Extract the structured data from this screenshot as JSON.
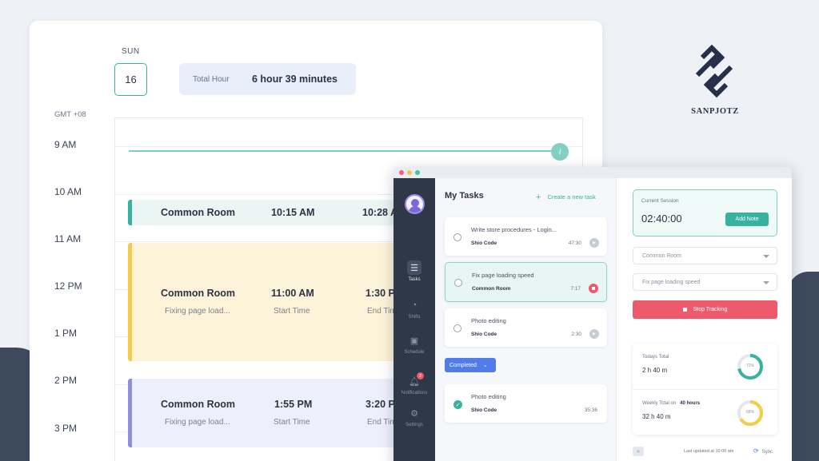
{
  "calendar": {
    "day_name": "SUN",
    "day_number": "16",
    "total_label": "Total Hour",
    "total_value": "6 hour 39 minutes",
    "timezone": "GMT +08",
    "hours": [
      "9 AM",
      "10 AM",
      "11 AM",
      "12 PM",
      "1 PM",
      "2 PM",
      "3 PM"
    ],
    "now_marker": "i",
    "events": [
      {
        "location": "Common Room",
        "start": "10:15 AM",
        "end": "10:28 A",
        "color": "#38b2a0"
      },
      {
        "location": "Common Room",
        "subtitle": "Fixing page load...",
        "start": "11:00 AM",
        "start_label": "Start Time",
        "end": "1:30 P",
        "end_label": "End Tim",
        "color": "#f4cc45"
      },
      {
        "location": "Common Room",
        "subtitle": "Fixing page load...",
        "start": "1:55 PM",
        "start_label": "Start Time",
        "end": "3:20 P",
        "end_label": "End Tim",
        "color": "#8e8edb"
      }
    ]
  },
  "brand": {
    "name": "SANPJOTZ"
  },
  "app": {
    "sidebar": [
      {
        "label": "Tasks",
        "icon": "list-icon",
        "active": true
      },
      {
        "label": "Shifts",
        "icon": "shifts-icon"
      },
      {
        "label": "Schedule",
        "icon": "calendar-icon"
      },
      {
        "label": "Notifications",
        "icon": "bell-icon",
        "badge": "2"
      },
      {
        "label": "Settings",
        "icon": "gear-icon"
      }
    ],
    "tasks_title": "My Tasks",
    "create_task": "Create a new task",
    "tasks": [
      {
        "title": "Write store procedures - Login...",
        "project": "Shio Code",
        "time": "47:30"
      },
      {
        "title": "Fix page loading speed",
        "project": "Common Room",
        "time": "7:17"
      },
      {
        "title": "Photo editing",
        "project": "Shio Code",
        "time": "2:30"
      }
    ],
    "completed_label": "Completed",
    "completed_tasks": [
      {
        "title": "Photo editing",
        "project": "Shio Code",
        "time": "35:36"
      }
    ],
    "session": {
      "label": "Current Session",
      "time": "02:40:00",
      "add_note": "Add Note",
      "room_select": "Common Room",
      "task_select": "Fix page loading speed",
      "stop_label": "Stop Tracking"
    },
    "stats": {
      "today_label": "Todays Total",
      "today_value": "2 h 40 m",
      "today_pct": "72%",
      "today_fraction": 0.72,
      "weekly_label": "Weekly Total on",
      "weekly_target": "40 hours",
      "weekly_value": "32 h 40 m",
      "weekly_pct": "66%",
      "weekly_fraction": 0.66
    },
    "footer": {
      "updated": "Last updated at 10:00 am",
      "sync": "Sync"
    }
  },
  "colors": {
    "accent": "#38b2a0",
    "danger": "#ee5a6b",
    "primary": "#4f7ce8",
    "ring_today": "#38b2a0",
    "ring_weekly": "#f4cc45"
  }
}
